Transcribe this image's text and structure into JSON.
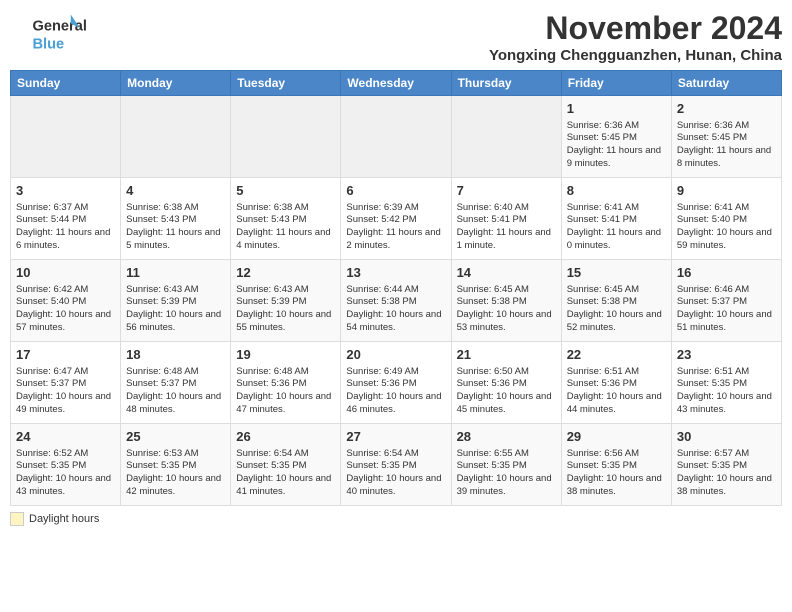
{
  "logo": {
    "line1": "General",
    "line2": "Blue"
  },
  "title": {
    "month": "November 2024",
    "location": "Yongxing Chengguanzhen, Hunan, China"
  },
  "weekdays": [
    "Sunday",
    "Monday",
    "Tuesday",
    "Wednesday",
    "Thursday",
    "Friday",
    "Saturday"
  ],
  "weeks": [
    [
      {
        "day": "",
        "info": ""
      },
      {
        "day": "",
        "info": ""
      },
      {
        "day": "",
        "info": ""
      },
      {
        "day": "",
        "info": ""
      },
      {
        "day": "",
        "info": ""
      },
      {
        "day": "1",
        "info": "Sunrise: 6:36 AM\nSunset: 5:45 PM\nDaylight: 11 hours and 9 minutes."
      },
      {
        "day": "2",
        "info": "Sunrise: 6:36 AM\nSunset: 5:45 PM\nDaylight: 11 hours and 8 minutes."
      }
    ],
    [
      {
        "day": "3",
        "info": "Sunrise: 6:37 AM\nSunset: 5:44 PM\nDaylight: 11 hours and 6 minutes."
      },
      {
        "day": "4",
        "info": "Sunrise: 6:38 AM\nSunset: 5:43 PM\nDaylight: 11 hours and 5 minutes."
      },
      {
        "day": "5",
        "info": "Sunrise: 6:38 AM\nSunset: 5:43 PM\nDaylight: 11 hours and 4 minutes."
      },
      {
        "day": "6",
        "info": "Sunrise: 6:39 AM\nSunset: 5:42 PM\nDaylight: 11 hours and 2 minutes."
      },
      {
        "day": "7",
        "info": "Sunrise: 6:40 AM\nSunset: 5:41 PM\nDaylight: 11 hours and 1 minute."
      },
      {
        "day": "8",
        "info": "Sunrise: 6:41 AM\nSunset: 5:41 PM\nDaylight: 11 hours and 0 minutes."
      },
      {
        "day": "9",
        "info": "Sunrise: 6:41 AM\nSunset: 5:40 PM\nDaylight: 10 hours and 59 minutes."
      }
    ],
    [
      {
        "day": "10",
        "info": "Sunrise: 6:42 AM\nSunset: 5:40 PM\nDaylight: 10 hours and 57 minutes."
      },
      {
        "day": "11",
        "info": "Sunrise: 6:43 AM\nSunset: 5:39 PM\nDaylight: 10 hours and 56 minutes."
      },
      {
        "day": "12",
        "info": "Sunrise: 6:43 AM\nSunset: 5:39 PM\nDaylight: 10 hours and 55 minutes."
      },
      {
        "day": "13",
        "info": "Sunrise: 6:44 AM\nSunset: 5:38 PM\nDaylight: 10 hours and 54 minutes."
      },
      {
        "day": "14",
        "info": "Sunrise: 6:45 AM\nSunset: 5:38 PM\nDaylight: 10 hours and 53 minutes."
      },
      {
        "day": "15",
        "info": "Sunrise: 6:45 AM\nSunset: 5:38 PM\nDaylight: 10 hours and 52 minutes."
      },
      {
        "day": "16",
        "info": "Sunrise: 6:46 AM\nSunset: 5:37 PM\nDaylight: 10 hours and 51 minutes."
      }
    ],
    [
      {
        "day": "17",
        "info": "Sunrise: 6:47 AM\nSunset: 5:37 PM\nDaylight: 10 hours and 49 minutes."
      },
      {
        "day": "18",
        "info": "Sunrise: 6:48 AM\nSunset: 5:37 PM\nDaylight: 10 hours and 48 minutes."
      },
      {
        "day": "19",
        "info": "Sunrise: 6:48 AM\nSunset: 5:36 PM\nDaylight: 10 hours and 47 minutes."
      },
      {
        "day": "20",
        "info": "Sunrise: 6:49 AM\nSunset: 5:36 PM\nDaylight: 10 hours and 46 minutes."
      },
      {
        "day": "21",
        "info": "Sunrise: 6:50 AM\nSunset: 5:36 PM\nDaylight: 10 hours and 45 minutes."
      },
      {
        "day": "22",
        "info": "Sunrise: 6:51 AM\nSunset: 5:36 PM\nDaylight: 10 hours and 44 minutes."
      },
      {
        "day": "23",
        "info": "Sunrise: 6:51 AM\nSunset: 5:35 PM\nDaylight: 10 hours and 43 minutes."
      }
    ],
    [
      {
        "day": "24",
        "info": "Sunrise: 6:52 AM\nSunset: 5:35 PM\nDaylight: 10 hours and 43 minutes."
      },
      {
        "day": "25",
        "info": "Sunrise: 6:53 AM\nSunset: 5:35 PM\nDaylight: 10 hours and 42 minutes."
      },
      {
        "day": "26",
        "info": "Sunrise: 6:54 AM\nSunset: 5:35 PM\nDaylight: 10 hours and 41 minutes."
      },
      {
        "day": "27",
        "info": "Sunrise: 6:54 AM\nSunset: 5:35 PM\nDaylight: 10 hours and 40 minutes."
      },
      {
        "day": "28",
        "info": "Sunrise: 6:55 AM\nSunset: 5:35 PM\nDaylight: 10 hours and 39 minutes."
      },
      {
        "day": "29",
        "info": "Sunrise: 6:56 AM\nSunset: 5:35 PM\nDaylight: 10 hours and 38 minutes."
      },
      {
        "day": "30",
        "info": "Sunrise: 6:57 AM\nSunset: 5:35 PM\nDaylight: 10 hours and 38 minutes."
      }
    ]
  ],
  "legend": {
    "daylight_label": "Daylight hours"
  }
}
